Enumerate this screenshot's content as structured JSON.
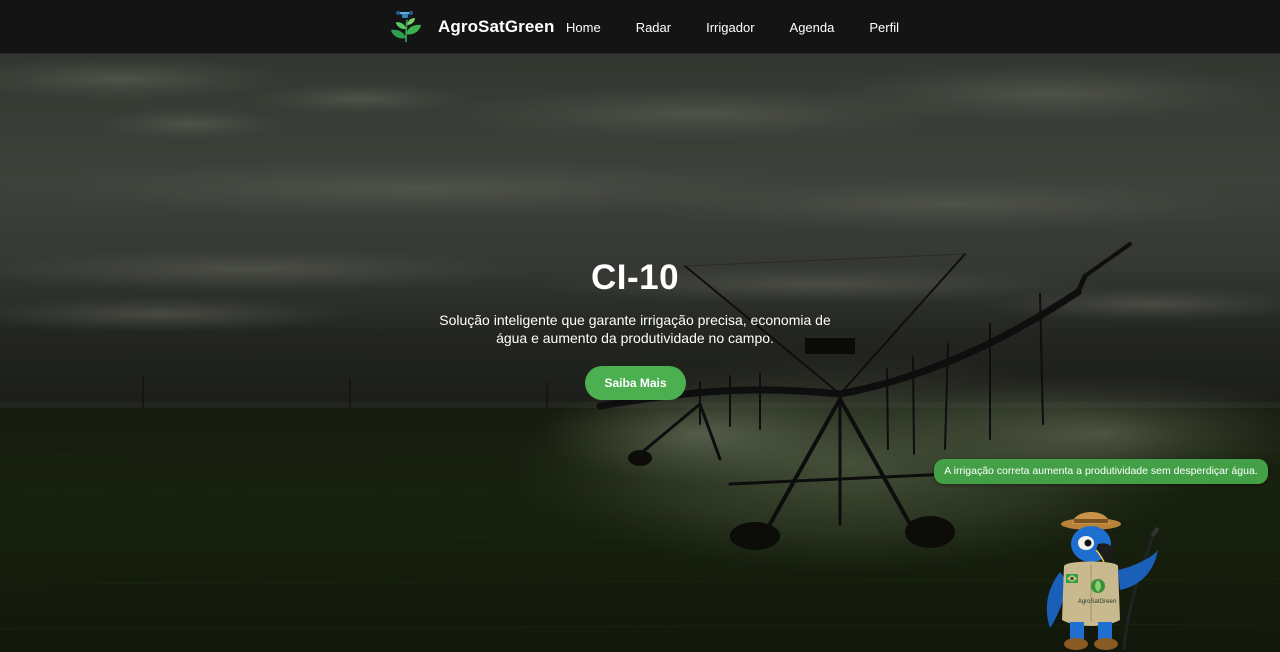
{
  "header": {
    "brand": "AgroSatGreen",
    "nav": [
      {
        "label": "Home"
      },
      {
        "label": "Radar"
      },
      {
        "label": "Irrigador"
      },
      {
        "label": "Agenda"
      },
      {
        "label": "Perfil"
      }
    ]
  },
  "hero": {
    "title": "CI-10",
    "description": "Solução inteligente que garante irrigação precisa, economia de água e aumento da produtividade no campo.",
    "cta_label": "Saiba Mais"
  },
  "assistant": {
    "tip": "A irrigação correta aumenta a produtividade sem desperdiçar água.",
    "badge_text": "AgroSatGreen"
  },
  "colors": {
    "accent": "#4caf50",
    "navbar": "#141414",
    "tip_bubble": "#43a047"
  }
}
